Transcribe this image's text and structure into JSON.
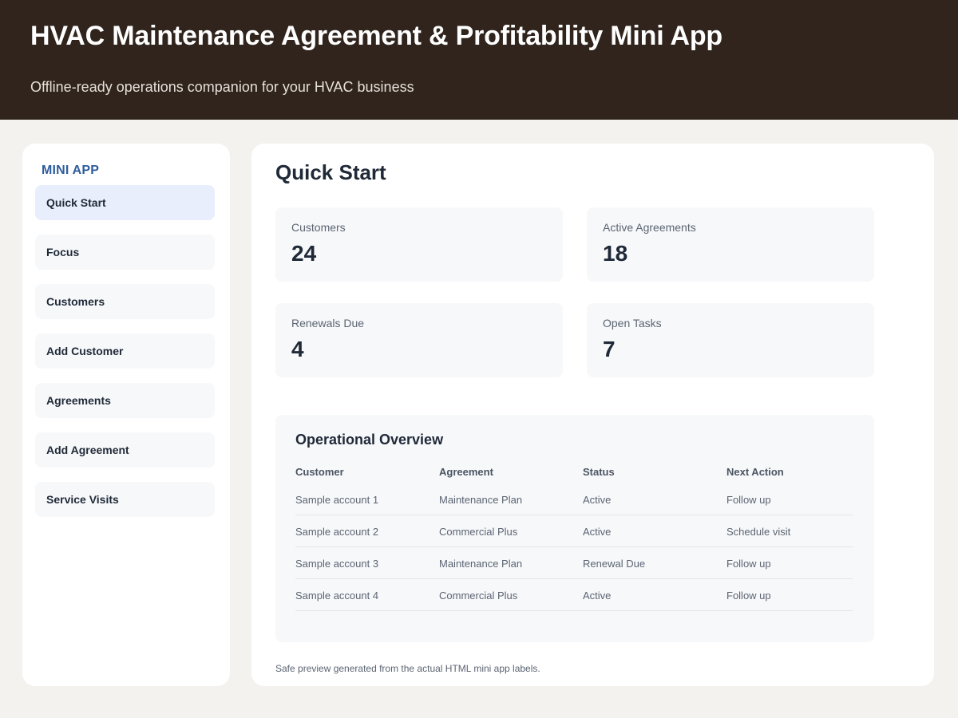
{
  "header": {
    "title": "HVAC Maintenance Agreement & Profitability Mini App",
    "subtitle": "Offline-ready operations companion for your HVAC business"
  },
  "sidebar": {
    "title": "MINI APP",
    "items": [
      {
        "label": "Quick Start"
      },
      {
        "label": "Focus"
      },
      {
        "label": "Customers"
      },
      {
        "label": "Add Customer"
      },
      {
        "label": "Agreements"
      },
      {
        "label": "Add Agreement"
      },
      {
        "label": "Service Visits"
      }
    ]
  },
  "main": {
    "title": "Quick Start",
    "stats": [
      {
        "label": "Customers",
        "value": "24"
      },
      {
        "label": "Active Agreements",
        "value": "18"
      },
      {
        "label": "Renewals Due",
        "value": "4"
      },
      {
        "label": "Open Tasks",
        "value": "7"
      }
    ],
    "overview": {
      "title": "Operational Overview",
      "columns": [
        "Customer",
        "Agreement",
        "Status",
        "Next Action"
      ],
      "rows": [
        [
          "Sample account 1",
          "Maintenance Plan",
          "Active",
          "Follow up"
        ],
        [
          "Sample account 2",
          "Commercial Plus",
          "Active",
          "Schedule visit"
        ],
        [
          "Sample account 3",
          "Maintenance Plan",
          "Renewal Due",
          "Follow up"
        ],
        [
          "Sample account 4",
          "Commercial Plus",
          "Active",
          "Follow up"
        ]
      ]
    },
    "footnote": "Safe preview generated from the actual HTML mini app labels."
  },
  "colors": {
    "header_bg": "#30241c",
    "accent": "#2f5d9c",
    "active_nav_bg": "#e8eefb",
    "page_bg": "#f3f2ee"
  }
}
